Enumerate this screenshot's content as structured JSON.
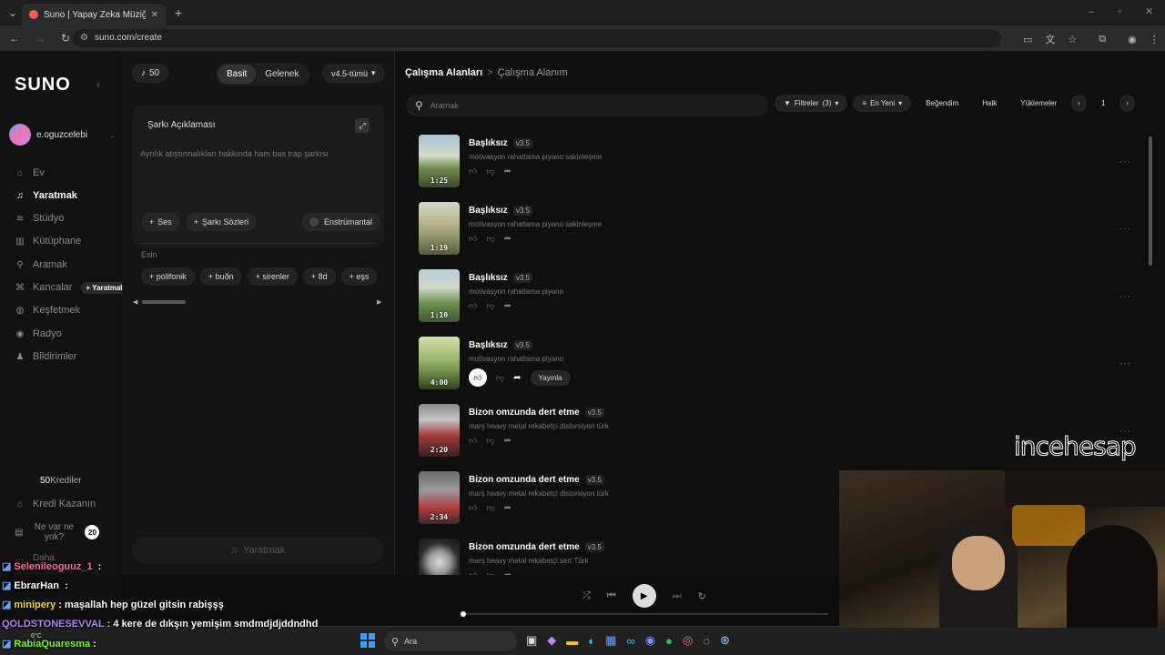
{
  "browser": {
    "tab_title": "Suno | Yapay Zeka Müziği",
    "url": "suno.com/create"
  },
  "sidebar": {
    "logo": "SUNO",
    "username": "e.oguzcelebi",
    "items": [
      {
        "label": "Ev",
        "icon": "home-icon"
      },
      {
        "label": "Yaratmak",
        "icon": "music-note-icon",
        "active": true
      },
      {
        "label": "Stüdyo",
        "icon": "studio-icon"
      },
      {
        "label": "Kütüphane",
        "icon": "library-icon"
      },
      {
        "label": "Aramak",
        "icon": "search-icon"
      },
      {
        "label": "Kancalar",
        "icon": "hook-icon",
        "badge": "+ Yaratmak"
      },
      {
        "label": "Keşfetmek",
        "icon": "compass-icon"
      },
      {
        "label": "Radyo",
        "icon": "radio-icon"
      },
      {
        "label": "Bildirimler",
        "icon": "bell-icon"
      }
    ],
    "credits_value": "50",
    "credits_label": "Krediler",
    "earn": "Kredi Kazanın",
    "whats_new": "Ne var ne yok?",
    "whats_new_count": "20",
    "more": "Daha"
  },
  "create": {
    "credits": "50",
    "mode_simple": "Basit",
    "mode_custom": "Gelenek",
    "model": "v4.5-tümü",
    "desc_label": "Şarkı Açıklaması",
    "desc_placeholder": "Ayrılık atıştırmalıkları hakkında ham bas trap şarkısı",
    "btn_audio": "Ses",
    "btn_lyrics": "Şarkı Sözleri",
    "btn_instrumental": "Enstrümantal",
    "inspo_label": "Esin",
    "tags": [
      "polifonik",
      "buðn",
      "sirenler",
      "8d",
      "eşs"
    ],
    "create_btn": "Yaratmak"
  },
  "main": {
    "breadcrumb_root": "Çalışma Alanları",
    "breadcrumb_sep": ">",
    "breadcrumb_current": "Çalışma Alanım",
    "search_placeholder": "Aramak",
    "filters": "Filtreler",
    "filters_count": "(3)",
    "sort": "En Yeni",
    "liked": "Beğendim",
    "public": "Halk",
    "uploads": "Yüklemeler",
    "page": "1",
    "publish_label": "Yayınla",
    "songs": [
      {
        "title": "Başlıksız",
        "version": "v3.5",
        "desc": "motivasyon rahatlama piyano sakinleşme",
        "duration": "1:25"
      },
      {
        "title": "Başlıksız",
        "version": "v3.5",
        "desc": "motivasyon rahatlama piyano sakinleşme",
        "duration": "1:19"
      },
      {
        "title": "Başlıksız",
        "version": "v3.5",
        "desc": "motivasyon rahatlama piyano",
        "duration": "1:10"
      },
      {
        "title": "Başlıksız",
        "version": "v3.5",
        "desc": "motivasyon rahatlama piyano",
        "duration": "4:00"
      },
      {
        "title": "Bizon omzunda dert etme",
        "version": "v3.5",
        "desc": "marş heavy metal rekabetçi distorsiyon türk",
        "duration": "2:20"
      },
      {
        "title": "Bizon omzunda dert etme",
        "version": "v3.5",
        "desc": "marş heavy metal rekabetçi distorsiyon türk",
        "duration": "2:34"
      },
      {
        "title": "Bizon omzunda dert etme",
        "version": "v3.5",
        "desc": "marş heavy metal rekabetçi sert Türk",
        "duration": ""
      }
    ]
  },
  "overlay": {
    "watermark": "incehesap",
    "chat": [
      {
        "user": "Selenileoguuz_1",
        "msg": "",
        "color": "#ff6b9d"
      },
      {
        "user": "EbrarHan",
        "msg": "",
        "color": "#ffffff"
      },
      {
        "user": "minipery",
        "msg": ": maşallah hep güzel gitsin rabişşş",
        "color": "#ffd23f"
      },
      {
        "user": "QOLDSTONESEVVAL",
        "msg": ": 4 kere de dıkşın yemişim smdmdjdjddndhd",
        "color": "#b388ff"
      },
      {
        "user": "RabiaQuaresma",
        "msg": ":",
        "color": "#7CFC00"
      }
    ]
  },
  "taskbar": {
    "search_placeholder": "Ara",
    "weather": "6°C"
  }
}
